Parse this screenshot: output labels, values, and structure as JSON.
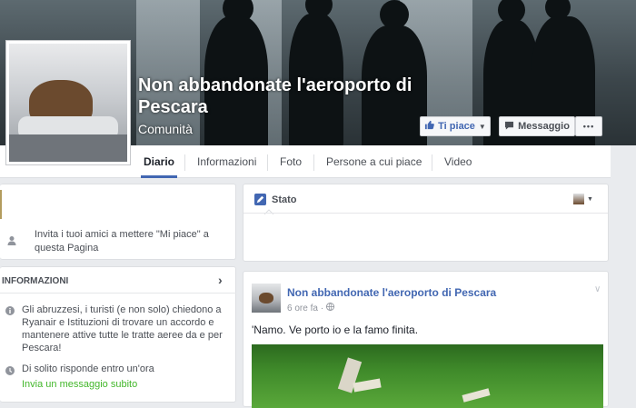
{
  "page": {
    "name": "Non abbandonate l'aeroporto di Pescara",
    "category": "Comunità"
  },
  "actions": {
    "like": "Ti piace",
    "message": "Messaggio",
    "more": "•••"
  },
  "tabs": [
    {
      "label": "Diario"
    },
    {
      "label": "Informazioni"
    },
    {
      "label": "Foto"
    },
    {
      "label": "Persone a cui piace"
    },
    {
      "label": "Video"
    }
  ],
  "invite": {
    "text": "Invita i tuoi amici a mettere \"Mi piace\" a questa Pagina"
  },
  "about": {
    "title": "INFORMAZIONI",
    "description": "Gli abruzzesi, i turisti (e non solo) chiedono a Ryanair e Istituzioni di trovare un accordo e mantenere attive tutte le tratte aeree da e per Pescara!",
    "response": "Di solito risponde entro un'ora",
    "send_message": "Invia un messaggio subito"
  },
  "composer": {
    "tab": "Stato"
  },
  "post": {
    "author": "Non abbandonate l'aeroporto di Pescara",
    "time": "6 ore fa",
    "privacy_sep": "·",
    "text": "'Namo. Ve porto io e la famo finita."
  },
  "colors": {
    "accent": "#4267b2",
    "background": "#e9ebee",
    "grass": "#3f8a2a"
  }
}
